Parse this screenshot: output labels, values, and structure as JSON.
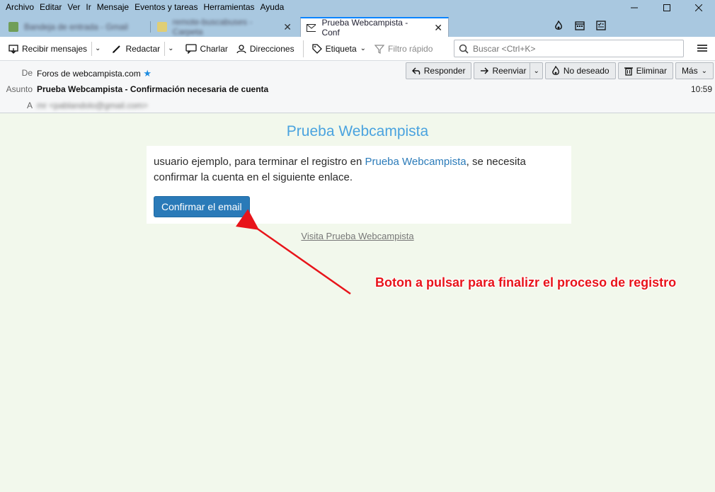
{
  "menu": [
    "Archivo",
    "Editar",
    "Ver",
    "Ir",
    "Mensaje",
    "Eventos y tareas",
    "Herramientas",
    "Ayuda"
  ],
  "tabs": [
    {
      "label": "Bandeja de entrada - Gmail",
      "active": false
    },
    {
      "label": "remote-buscabuses - Carpeta",
      "active": false
    },
    {
      "label": "Prueba Webcampista - Conf",
      "active": true
    }
  ],
  "toolbar": {
    "get_mail": "Recibir mensajes",
    "compose": "Redactar",
    "chat": "Charlar",
    "address_book": "Direcciones",
    "tag": "Etiqueta",
    "quick_filter": "Filtro rápido",
    "search_placeholder": "Buscar <Ctrl+K>"
  },
  "header": {
    "from_label": "De",
    "from_value": "Foros de webcampista.com",
    "subject_label": "Asunto",
    "subject_value": "Prueba Webcampista - Confirmación necesaria de cuenta",
    "to_label": "A",
    "to_value": "mr <pablandolo@gmail.com>",
    "time": "10:59",
    "actions": {
      "reply": "Responder",
      "forward": "Reenviar",
      "junk": "No deseado",
      "delete": "Eliminar",
      "more": "Más"
    }
  },
  "email": {
    "site_title": "Prueba Webcampista",
    "text_before": "usuario ejemplo, para terminar el registro en ",
    "text_link": "Prueba Webcampista",
    "text_after": ", se necesita confirmar la cuenta en el siguiente enlace.",
    "confirm_button": "Confirmar el email",
    "visit_link": "Visita Prueba Webcampista"
  },
  "annotation": "Boton a pulsar para finalizr el proceso de registro",
  "colors": {
    "accent": "#2a7ab8",
    "title_blue": "#4aa3df",
    "annotation_red": "#e8141a",
    "body_bg": "#f2f8ec"
  }
}
